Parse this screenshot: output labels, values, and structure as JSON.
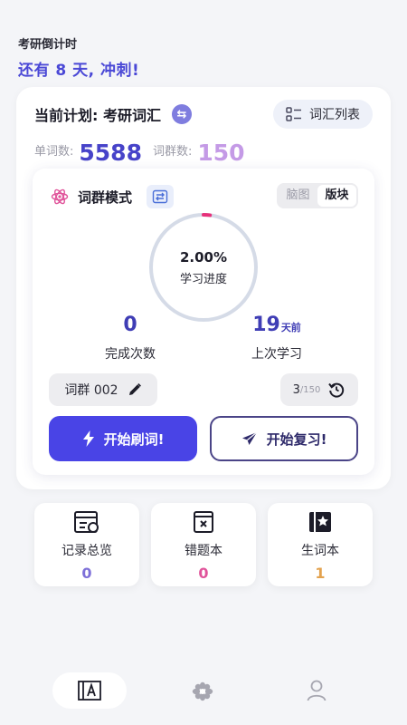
{
  "countdown": {
    "label": "考研倒计时",
    "message": "还有 8 天, 冲刺!"
  },
  "plan": {
    "title": "当前计划: 考研词汇",
    "vocab_list_label": "词汇列表",
    "word_count_label": "单词数:",
    "word_count": "5588",
    "group_count_label": "词群数:",
    "group_count": "150"
  },
  "mode": {
    "title": "词群模式",
    "view_options": [
      "脑图",
      "版块"
    ],
    "active_view": "版块",
    "progress": {
      "percent_text": "2.00%",
      "label": "学习进度",
      "value": 0.02
    },
    "completed": {
      "value": "0",
      "label": "完成次数"
    },
    "last_study": {
      "value": "19",
      "unit": "天前",
      "label": "上次学习"
    },
    "group_chip": "词群 002",
    "page": {
      "current": "3",
      "total": "/150"
    },
    "start_button": "开始刷词!",
    "review_button": "开始复习!"
  },
  "tiles": [
    {
      "label": "记录总览",
      "value": "0",
      "color": "#7d6fd8",
      "icon": "record-overview-icon"
    },
    {
      "label": "错题本",
      "value": "0",
      "color": "#e0539a",
      "icon": "wrong-book-icon"
    },
    {
      "label": "生词本",
      "value": "1",
      "color": "#e3a24e",
      "icon": "new-words-icon"
    }
  ],
  "tabbar": {
    "items": [
      "home-dictionary-icon",
      "flower-icon",
      "user-icon"
    ]
  },
  "colors": {
    "accent": "#4944e6",
    "ring_track": "#d5dbe7",
    "ring_progress": "#e6317a"
  }
}
